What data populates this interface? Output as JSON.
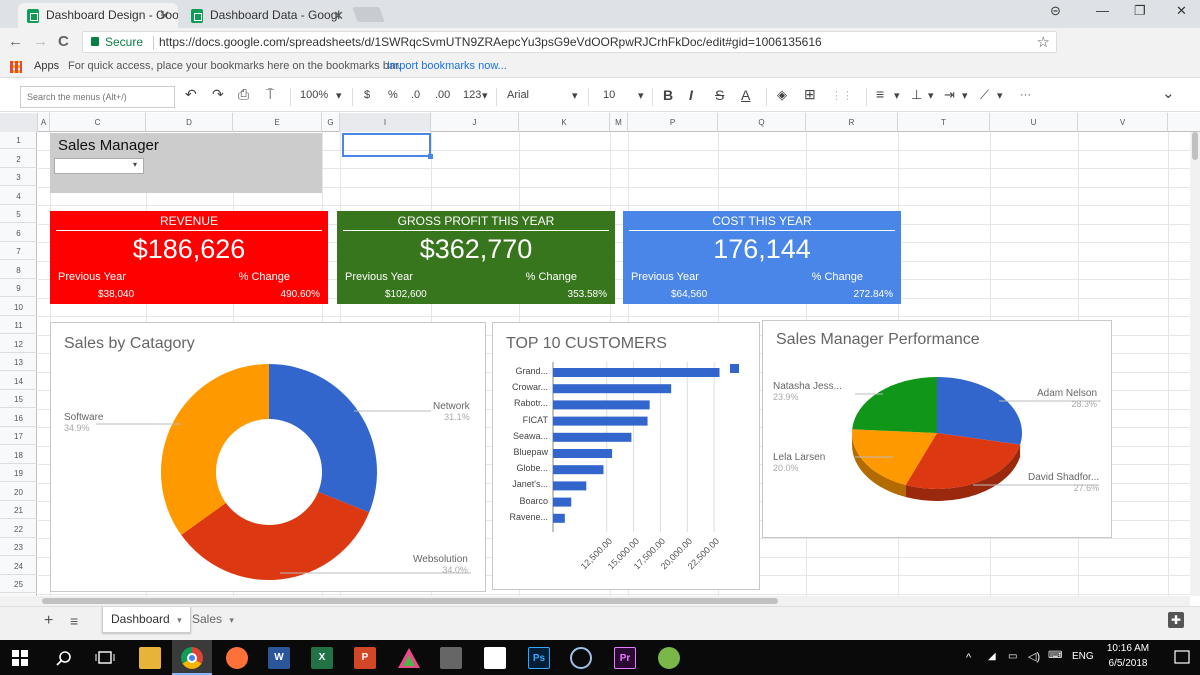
{
  "browser": {
    "tabs": [
      {
        "title": "Dashboard Design - Goo",
        "active": true
      },
      {
        "title": "Dashboard Data - Googl",
        "active": false
      }
    ],
    "tab_close": "✕",
    "window_controls": {
      "profile": "⊝",
      "minimize": "—",
      "restore": "❐",
      "close": "✕"
    },
    "nav": {
      "back": "←",
      "forward": "→",
      "reload": "C"
    },
    "secure_label": "Secure",
    "url": "https://docs.google.com/spreadsheets/d/1SWRqcSvmUTN9ZRAepcYu3psG9eVdOORpwRJCrhFkDoc/edit#gid=1006135616",
    "bookmark_star": "☆",
    "bookmarks": {
      "apps": "Apps",
      "hint": "For quick access, place your bookmarks here on the bookmarks bar.",
      "import": "Import bookmarks now..."
    }
  },
  "toolbar": {
    "search_placeholder": "Search the menus (Alt+/)",
    "undo": "↶",
    "redo": "↷",
    "print": "⎙",
    "paint_format": "⍑",
    "zoom": "100%",
    "currency": "$",
    "percent": "%",
    "dec_less": ".0",
    "dec_more": ".00",
    "more_formats": "123",
    "font": "Arial",
    "font_size": "10",
    "bold": "B",
    "italic": "I",
    "strike": "S",
    "text_color": "A",
    "fill": "◈",
    "borders": "⊞",
    "merge": "⋮⋮",
    "align": "≡",
    "valign": "⊥",
    "wrap": "⇥",
    "rotate": "⟋",
    "more": "···",
    "dropdown": "▾",
    "collapse": "⌄"
  },
  "sheet": {
    "columns": [
      "A",
      "C",
      "D",
      "E",
      "G",
      "I",
      "J",
      "K",
      "M",
      "P",
      "Q",
      "R",
      "T",
      "U",
      "V"
    ],
    "rows": [
      "1",
      "2",
      "3",
      "4",
      "5",
      "6",
      "7",
      "8",
      "9",
      "10",
      "11",
      "12",
      "13",
      "14",
      "15",
      "16",
      "17",
      "18",
      "19",
      "20",
      "21",
      "22",
      "23",
      "24",
      "25"
    ]
  },
  "dashboard": {
    "manager_title": "Sales Manager",
    "manager_dropdown_arrow": "▾",
    "kpis": [
      {
        "title": "REVENUE",
        "value": "$186,626",
        "prev_label": "Previous Year",
        "change_label": "% Change",
        "prev_value": "$38,040",
        "change_value": "490.60%",
        "color": "#ff0000"
      },
      {
        "title": "GROSS PROFIT THIS YEAR",
        "value": "$362,770",
        "prev_label": "Previous Year",
        "change_label": "% Change",
        "prev_value": "$102,600",
        "change_value": "353.58%",
        "color": "#38761d"
      },
      {
        "title": "COST THIS YEAR",
        "value": "176,144",
        "prev_label": "Previous Year",
        "change_label": "% Change",
        "prev_value": "$64,560",
        "change_value": "272.84%",
        "color": "#4a86e8"
      }
    ]
  },
  "chart_data": [
    {
      "type": "pie",
      "title": "Sales by Catagory",
      "donut": true,
      "slices": [
        {
          "label": "Network",
          "pct_label": "31.1%",
          "value": 31.1,
          "color": "#3366cc"
        },
        {
          "label": "Websolution",
          "pct_label": "34.0%",
          "value": 34.0,
          "color": "#dc3912"
        },
        {
          "label": "Software",
          "pct_label": "34.9%",
          "value": 34.9,
          "color": "#ff9900"
        }
      ]
    },
    {
      "type": "bar",
      "orientation": "horizontal",
      "title": "TOP 10 CUSTOMERS",
      "categories": [
        "Grand...",
        "Crowar...",
        "Rabotr...",
        "FICAT",
        "Seawa...",
        "Bluepaw",
        "Globe...",
        "Janet's...",
        "Boarco",
        "Ravene..."
      ],
      "values": [
        23000,
        18500,
        16500,
        16300,
        14800,
        13000,
        12200,
        10600,
        9200,
        8600
      ],
      "xlim": [
        7500,
        25000
      ],
      "tick_labels": [
        "12,500.00",
        "15,000.00",
        "17,500.00",
        "20,000.00",
        "22,500.00"
      ],
      "tick_values": [
        12500,
        15000,
        17500,
        20000,
        22500
      ],
      "color": "#3366cc"
    },
    {
      "type": "pie",
      "title": "Sales Manager Performance",
      "three_d": true,
      "slices": [
        {
          "label": "Adam Nelson",
          "pct_label": "28.3%",
          "value": 28.3,
          "color": "#3366cc"
        },
        {
          "label": "David Shadfor...",
          "pct_label": "27.6%",
          "value": 27.6,
          "color": "#dc3912"
        },
        {
          "label": "Lela Larsen",
          "pct_label": "20.0%",
          "value": 20.0,
          "color": "#ff9900"
        },
        {
          "label": "Natasha Jess...",
          "pct_label": "23.9%",
          "value": 23.9,
          "color": "#109618"
        }
      ]
    }
  ],
  "sheet_tabs": {
    "add": "+",
    "list": "≡",
    "tabs": [
      "Dashboard",
      "Sales"
    ],
    "tab_arrow": "▾",
    "explore": "✚"
  },
  "taskbar": {
    "clock_time": "10:16 AM",
    "clock_date": "6/5/2018",
    "lang": "ENG",
    "apps": [
      "W",
      "X",
      "P",
      "Ps",
      "Pr"
    ]
  }
}
